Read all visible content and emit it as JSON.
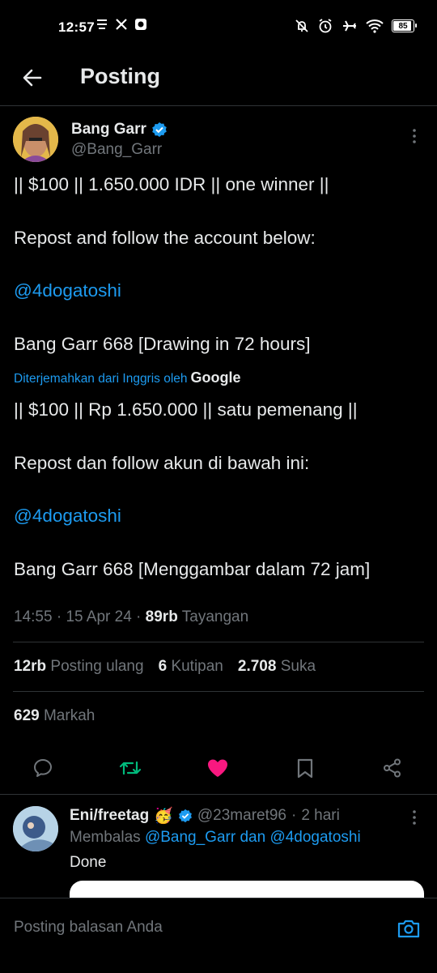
{
  "status_bar": {
    "time": "12:57",
    "battery": "85"
  },
  "header": {
    "title": "Posting"
  },
  "author": {
    "name": "Bang Garr",
    "handle": "@Bang_Garr"
  },
  "tweet": {
    "line1": "|| $100 || 1.650.000 IDR || one winner ||",
    "line2": "Repost and follow the account below:",
    "mention1": "@4dogatoshi",
    "line3": "Bang Garr 668 [Drawing in 72 hours]",
    "translated_label": "Diterjemahkan dari Inggris oleh",
    "translated_by": "Google",
    "tline1": "|| $100 || Rp 1.650.000 || satu pemenang ||",
    "tline2": "Repost dan follow akun di bawah ini:",
    "tmention": "@4dogatoshi",
    "tline3": "Bang Garr 668 [Menggambar dalam 72 jam]"
  },
  "meta": {
    "time": "14:55",
    "date": "15 Apr 24",
    "views_count": "89rb",
    "views_label": "Tayangan"
  },
  "stats": {
    "reposts_count": "12rb",
    "reposts_label": "Posting ulang",
    "quotes_count": "6",
    "quotes_label": "Kutipan",
    "likes_count": "2.708",
    "likes_label": "Suka",
    "bookmarks_count": "629",
    "bookmarks_label": "Markah"
  },
  "colors": {
    "accent": "#1d9bf0",
    "retweet": "#00ba7c",
    "like": "#f91880"
  },
  "reply": {
    "name": "Eni/freetag",
    "emoji": "🥳",
    "handle": "@23maret96",
    "time": "2 hari",
    "replying_prefix": "Membalas",
    "replying_user1": "@Bang_Garr",
    "replying_and": "dan",
    "replying_user2": "@4dogatoshi",
    "body": "Done"
  },
  "composer": {
    "placeholder": "Posting balasan Anda"
  }
}
